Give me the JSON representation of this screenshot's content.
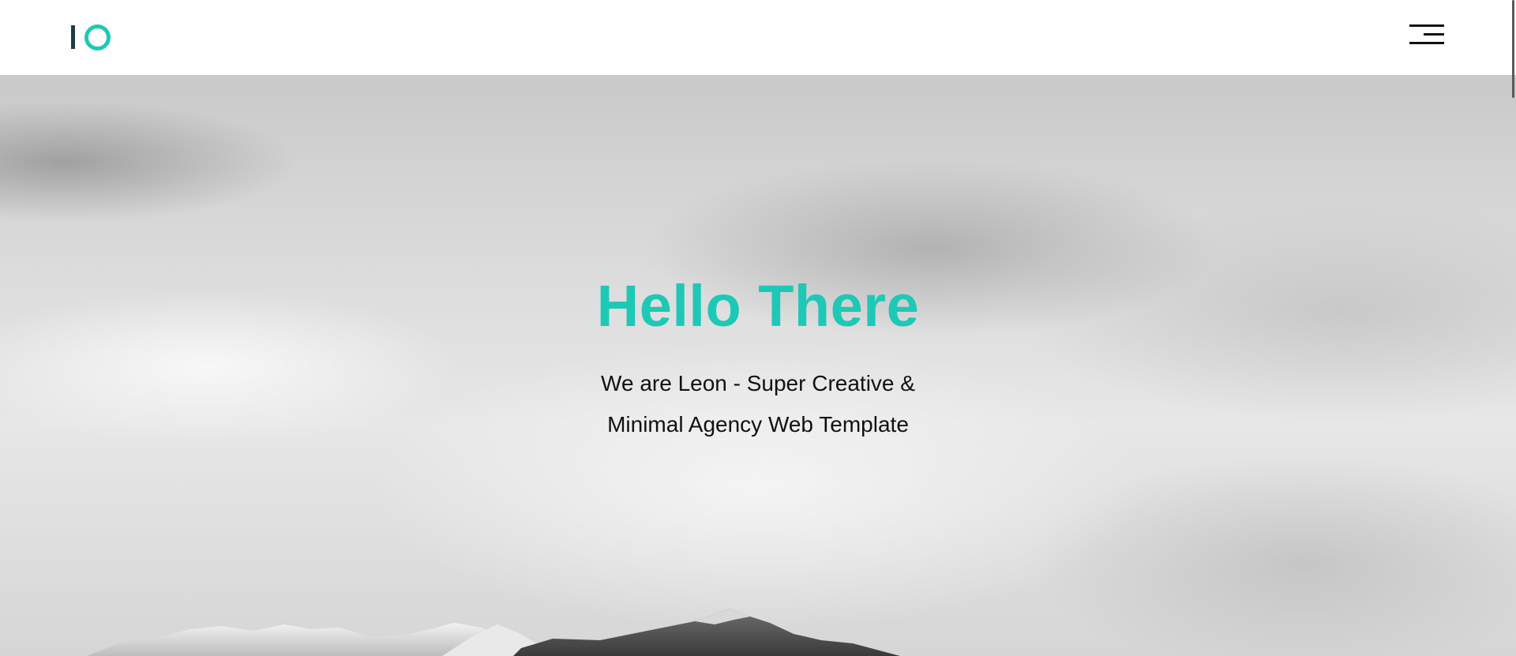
{
  "header": {
    "logo_icon": "io-logo-icon",
    "menu_icon": "hamburger-menu-icon"
  },
  "hero": {
    "title": "Hello There",
    "subtitle_line1": "We are Leon - Super Creative &",
    "subtitle_line2": "Minimal Agency Web Template",
    "background_icon": "mountain-sky-image"
  },
  "colors": {
    "accent": "#1ec8b6",
    "logo_dark": "#1d3c45",
    "text": "#111111",
    "header_bg": "#ffffff"
  }
}
